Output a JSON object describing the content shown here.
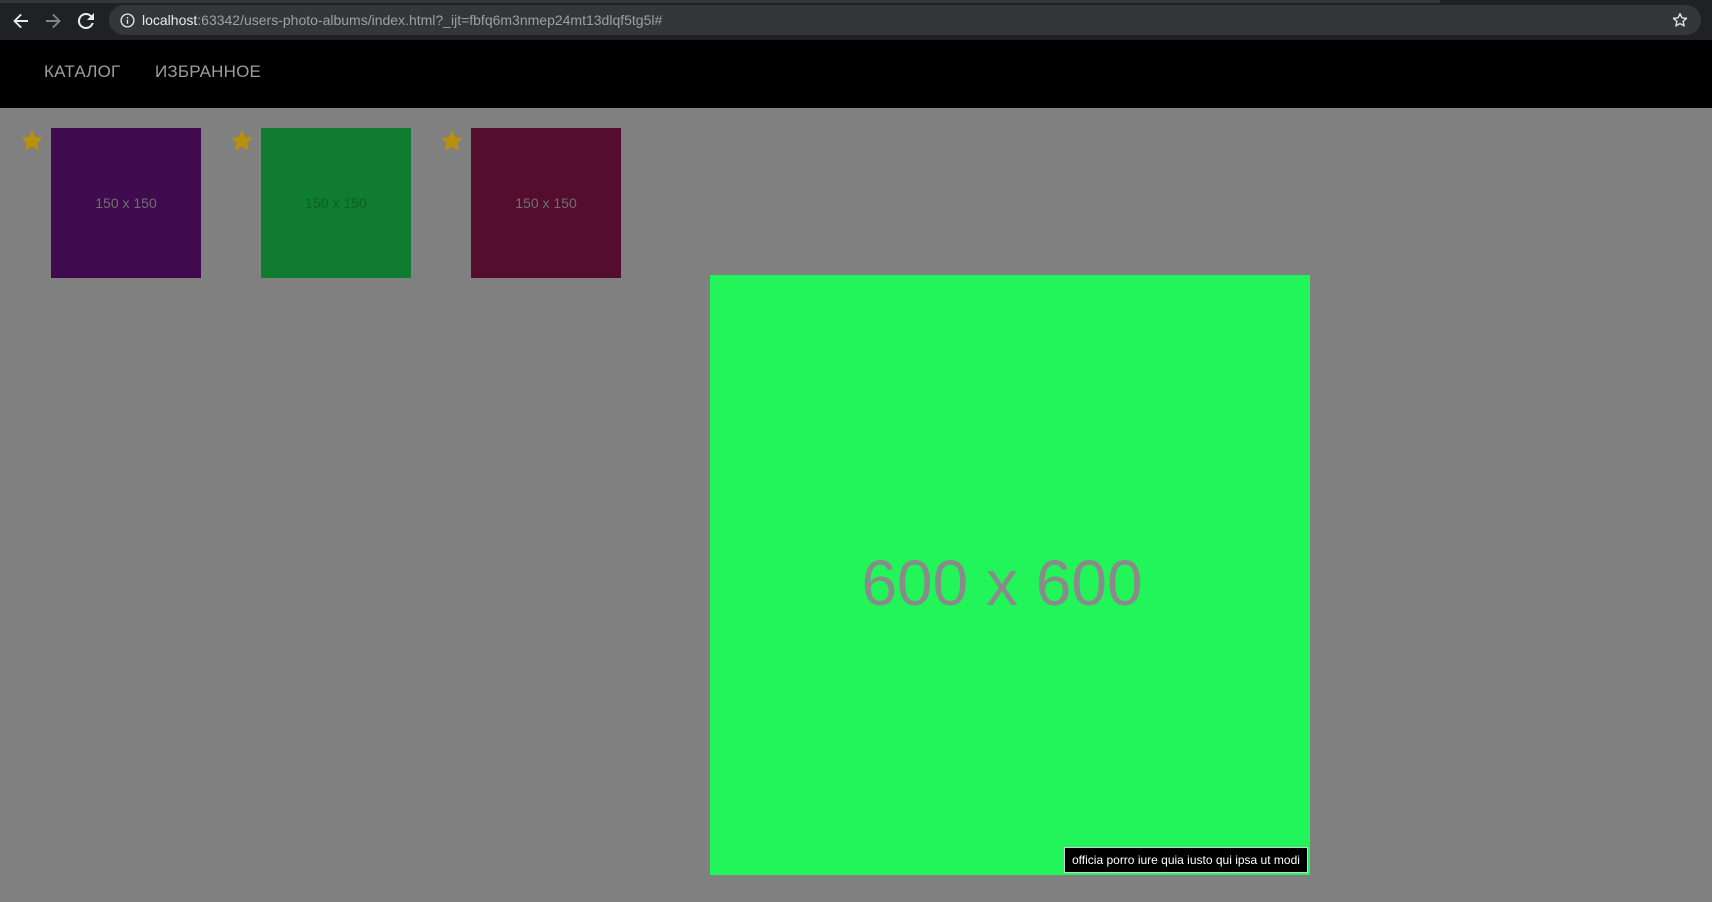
{
  "browser": {
    "url_host": "localhost",
    "url_rest": ":63342/users-photo-albums/index.html?_ijt=fbfq6m3nmep24mt13dlqf5tg5l#",
    "icons": {
      "back": "arrow-back-icon",
      "forward": "arrow-forward-icon",
      "reload": "reload-icon",
      "site_info": "info-icon",
      "bookmark": "star-outline-icon"
    }
  },
  "nav": {
    "items": [
      {
        "label": "КАТАЛОГ"
      },
      {
        "label": "ИЗБРАННОЕ"
      }
    ]
  },
  "thumbnails": [
    {
      "label": "150 x 150",
      "color": "#3f0b4e",
      "favorite": true
    },
    {
      "label": "150 x 150",
      "color": "#107c30",
      "favorite": true
    },
    {
      "label": "150 x 150",
      "color": "#540d2e",
      "favorite": true
    }
  ],
  "colors": {
    "page_bg": "#808080",
    "nav_bg": "#000000",
    "star": "#b8900c",
    "preview_bg": "#22f55a"
  },
  "preview": {
    "label": "600 x 600",
    "color": "#22f55a"
  },
  "tooltip": {
    "text": "officia porro iure quia iusto qui ipsa ut modi"
  }
}
